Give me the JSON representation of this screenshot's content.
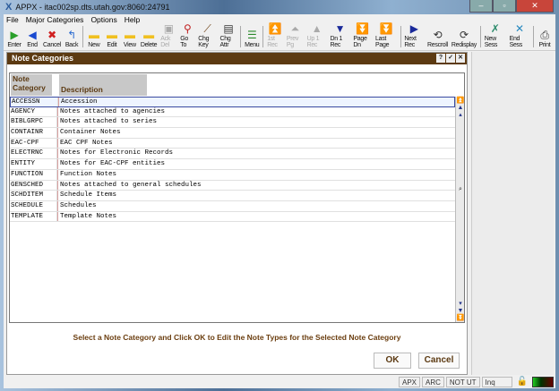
{
  "window": {
    "title": "APPX - itac002sp.dts.utah.gov:8060:24791",
    "app_icon": "x-logo-icon"
  },
  "menu": [
    "File",
    "Major Categories",
    "Options",
    "Help"
  ],
  "toolbar": [
    {
      "label": "Enter",
      "icon": "play-icon",
      "color": "#2aa02a",
      "enabled": true
    },
    {
      "label": "End",
      "icon": "back-arrow-icon",
      "color": "#1a4ad0",
      "enabled": true
    },
    {
      "label": "Cancel",
      "icon": "cancel-icon",
      "color": "#d02020",
      "enabled": true
    },
    {
      "label": "Back",
      "icon": "back-icon",
      "color": "#2a6ad0",
      "enabled": true
    },
    {
      "sep": true
    },
    {
      "label": "New",
      "icon": "folder-new-icon",
      "color": "#f0c020",
      "enabled": true
    },
    {
      "label": "Edit",
      "icon": "folder-edit-icon",
      "color": "#f0c020",
      "enabled": true
    },
    {
      "label": "View",
      "icon": "folder-view-icon",
      "color": "#f0c020",
      "enabled": true
    },
    {
      "label": "Delete",
      "icon": "folder-delete-icon",
      "color": "#f0c020",
      "enabled": true
    },
    {
      "label": "Ack Del",
      "icon": "tv-icon",
      "color": "#aaaaaa",
      "enabled": false
    },
    {
      "label": "Go To",
      "icon": "magnifier-icon",
      "color": "#c02020",
      "enabled": true
    },
    {
      "label": "Chg Key",
      "icon": "key-icon",
      "color": "#6b3e10",
      "enabled": true
    },
    {
      "label": "Chg Attr",
      "icon": "attr-icon",
      "color": "#333333",
      "enabled": true
    },
    {
      "sep": true
    },
    {
      "label": "Menu",
      "icon": "menu-icon",
      "color": "#2a8a2a",
      "enabled": true
    },
    {
      "sep": true
    },
    {
      "label": "1st Rec",
      "icon": "first-icon",
      "color": "#aaaaaa",
      "enabled": false
    },
    {
      "label": "Prev Pg",
      "icon": "prev-page-icon",
      "color": "#aaaaaa",
      "enabled": false
    },
    {
      "label": "Up 1 Rec",
      "icon": "up-icon",
      "color": "#aaaaaa",
      "enabled": false
    },
    {
      "label": "Dn 1 Rec",
      "icon": "down-icon",
      "color": "#1a2a9a",
      "enabled": true
    },
    {
      "label": "Page Dn",
      "icon": "page-down-icon",
      "color": "#1a2a9a",
      "enabled": true
    },
    {
      "label": "Last Page",
      "icon": "last-page-icon",
      "color": "#1a2a9a",
      "enabled": true
    },
    {
      "sep": true
    },
    {
      "label": "Next Rec",
      "icon": "next-icon",
      "color": "#1a2a9a",
      "enabled": true
    },
    {
      "label": "Rescroll",
      "icon": "rescroll-icon",
      "color": "#333333",
      "enabled": true
    },
    {
      "label": "Redisplay",
      "icon": "redisplay-icon",
      "color": "#333333",
      "enabled": true
    },
    {
      "sep": true
    },
    {
      "label": "New Sess",
      "icon": "new-session-icon",
      "color": "#2a8a6a",
      "enabled": true
    },
    {
      "label": "End Sess",
      "icon": "end-session-icon",
      "color": "#2a8ac0",
      "enabled": true
    },
    {
      "sep": true
    },
    {
      "label": "Print",
      "icon": "printer-icon",
      "color": "#333333",
      "enabled": true
    }
  ],
  "panel": {
    "title": "Note Categories",
    "buttons": [
      "?",
      "✓",
      "✕"
    ],
    "columns": {
      "category": "Note Category",
      "description": "Description"
    },
    "rows": [
      [
        "ACCESSN",
        "Accession"
      ],
      [
        "AGENCY",
        "Notes attached to agencies"
      ],
      [
        "BIBLGRPC",
        "Notes attached to series"
      ],
      [
        "CONTAINR",
        "Container Notes"
      ],
      [
        "EAC-CPF",
        "EAC CPF Notes"
      ],
      [
        "ELECTRNC",
        "Notes for Electronic Records"
      ],
      [
        "ENTITY",
        "Notes for EAC-CPF entities"
      ],
      [
        "FUNCTION",
        "Function Notes"
      ],
      [
        "GENSCHED",
        "Notes attached to general schedules"
      ],
      [
        "SCHDITEM",
        "Schedule Items"
      ],
      [
        "SCHEDULE",
        "Schedules"
      ],
      [
        "TEMPLATE",
        "Template Notes"
      ]
    ],
    "message": "Select a Note Category and Click OK to Edit the Note Types for the Selected Note Category",
    "ok": "OK",
    "cancel": "Cancel"
  },
  "status": [
    "APX",
    "ARC",
    "NOT UT",
    "Inq"
  ]
}
